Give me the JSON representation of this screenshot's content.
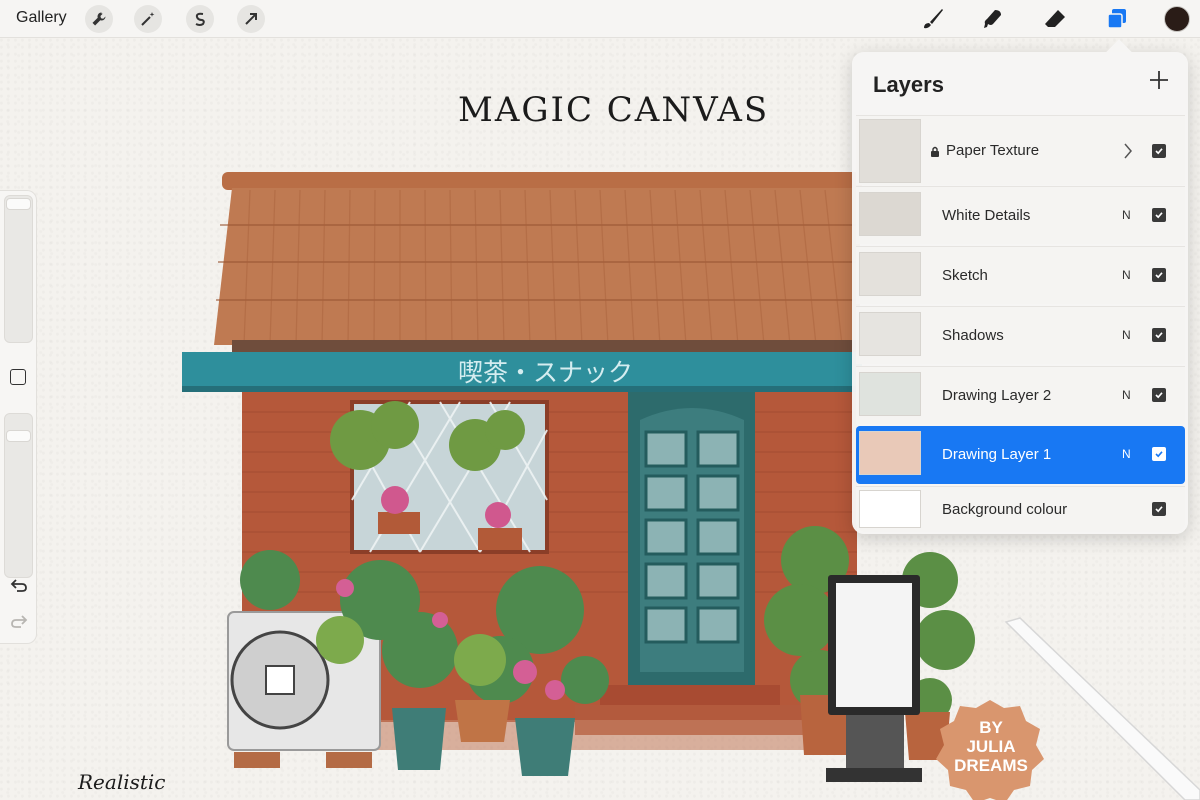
{
  "toolbar": {
    "gallery_label": "Gallery",
    "left_tools": [
      "wrench-icon",
      "magic-wand-icon",
      "selection-s-icon",
      "arrow-cursor-icon"
    ],
    "right_tools": [
      "brush-icon",
      "smudge-icon",
      "eraser-icon",
      "layers-icon"
    ],
    "active_tool": "layers-icon",
    "current_color": "#2a1c17",
    "accent_color": "#1878f3"
  },
  "sidebar": {
    "brush_size_level": 0.0,
    "opacity_level": 0.0,
    "icons": [
      "modify-square-icon",
      "undo-icon",
      "redo-icon"
    ]
  },
  "artwork": {
    "title": "MAGIC CANVAS",
    "sign_text": "喫茶・スナック",
    "caption": "Realistic",
    "badge_lines": [
      "BY",
      "JULIA",
      "DREAMS"
    ]
  },
  "layers_panel": {
    "title": "Layers",
    "add_icon": "plus-icon",
    "rows": [
      {
        "name": "Paper Texture",
        "blend": "",
        "visible": true,
        "locked": true,
        "has_chevron": true,
        "selected": false
      },
      {
        "name": "White Details",
        "blend": "N",
        "visible": true,
        "locked": false,
        "has_chevron": false,
        "selected": false
      },
      {
        "name": "Sketch",
        "blend": "N",
        "visible": true,
        "locked": false,
        "has_chevron": false,
        "selected": false
      },
      {
        "name": "Shadows",
        "blend": "N",
        "visible": true,
        "locked": false,
        "has_chevron": false,
        "selected": false
      },
      {
        "name": "Drawing Layer 2",
        "blend": "N",
        "visible": true,
        "locked": false,
        "has_chevron": false,
        "selected": false
      },
      {
        "name": "Drawing Layer 1",
        "blend": "N",
        "visible": true,
        "locked": false,
        "has_chevron": false,
        "selected": true
      },
      {
        "name": "Background colour",
        "blend": "",
        "visible": true,
        "locked": false,
        "has_chevron": false,
        "selected": false
      }
    ]
  }
}
